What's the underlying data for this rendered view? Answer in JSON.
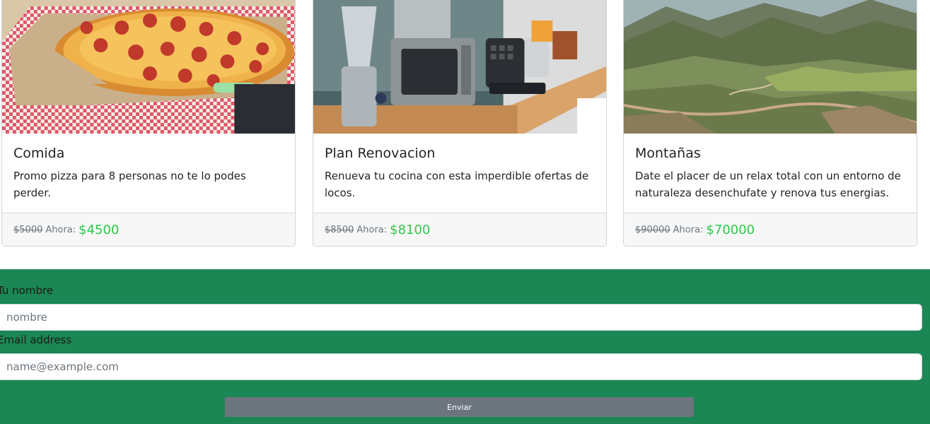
{
  "cards": [
    {
      "title": "Comida",
      "text": "Promo pizza para 8 personas no te lo podes perder.",
      "old_price": "$5000",
      "now_label": "Ahora:",
      "new_price": "$4500",
      "image_icon": "pizza-image"
    },
    {
      "title": "Plan Renovacion",
      "text": "Renueva tu cocina con esta imperdible ofertas de locos.",
      "old_price": "$8500",
      "now_label": "Ahora:",
      "new_price": "$8100",
      "image_icon": "kitchen-appliances-image"
    },
    {
      "title": "Montañas",
      "text": "Date el placer de un relax total con un entorno de naturaleza desenchufate y renova tus energias.",
      "old_price": "$90000",
      "now_label": "Ahora:",
      "new_price": "$70000",
      "image_icon": "mountains-image"
    }
  ],
  "form": {
    "name_label": "Tu nombre",
    "name_placeholder": "nombre",
    "email_label": "Email address",
    "email_placeholder": "name@example.com",
    "submit_label": "Enviar"
  },
  "colors": {
    "form_background": "#1b8754",
    "new_price": "#2fc94b",
    "button": "#6c757d"
  }
}
